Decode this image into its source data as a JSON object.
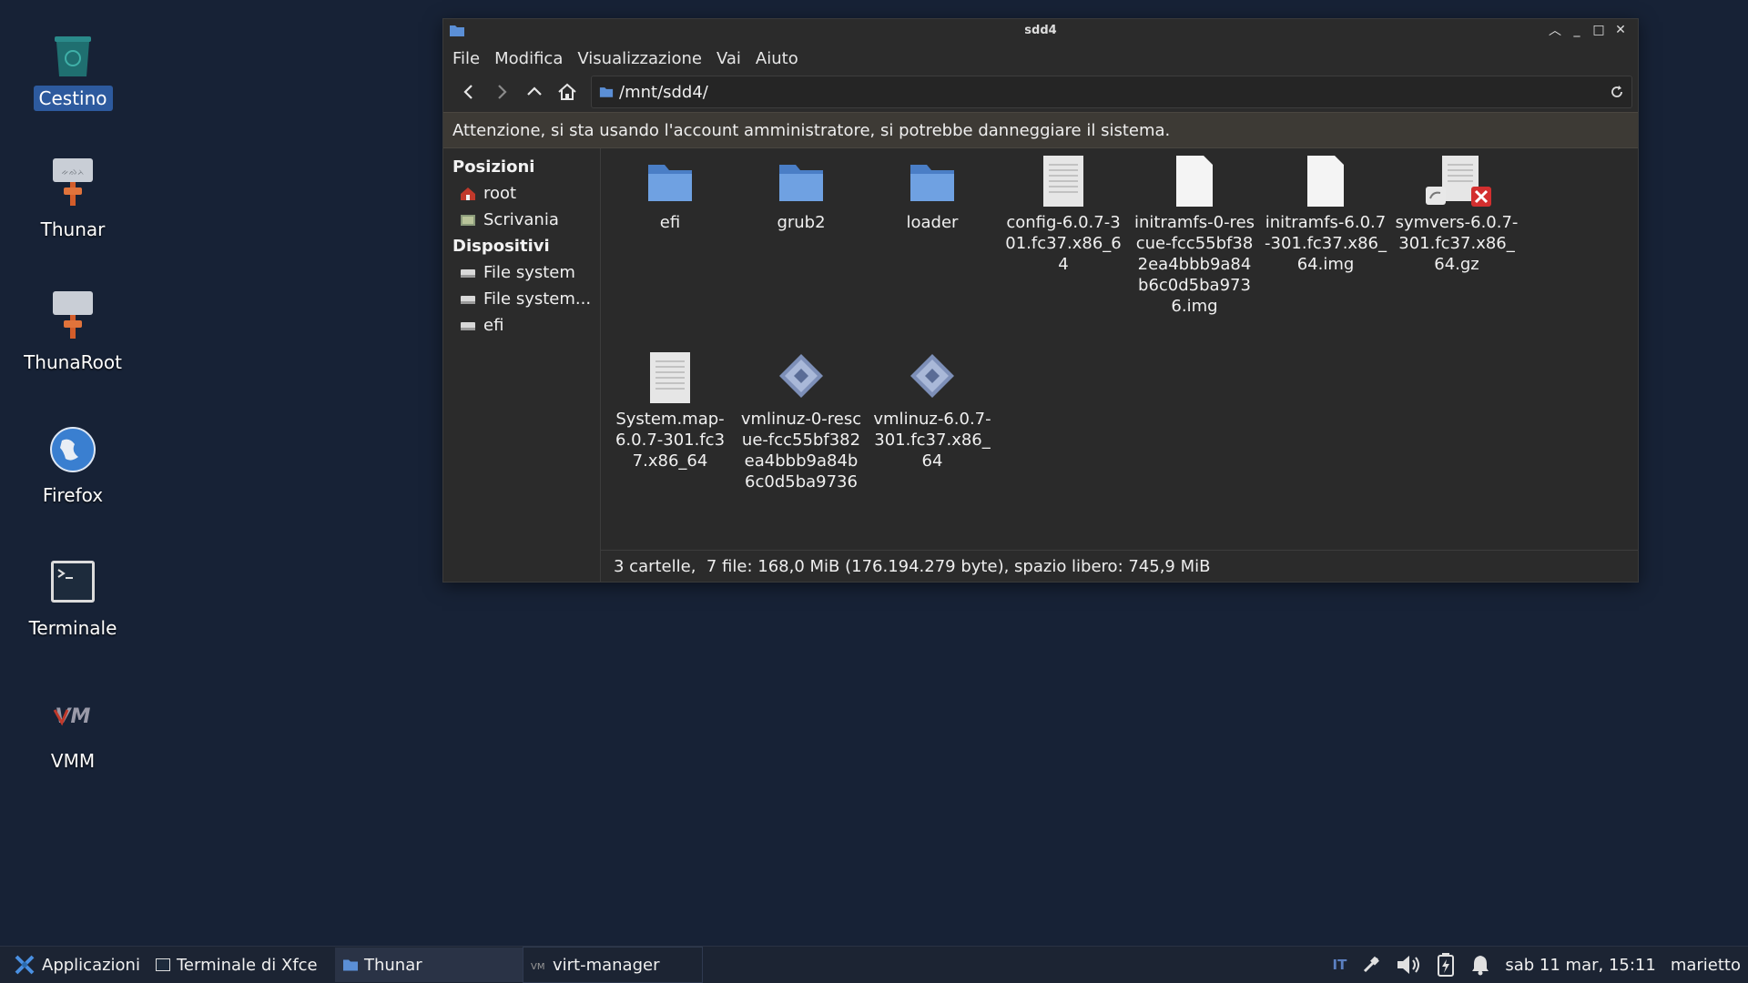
{
  "desktop": {
    "icons": [
      {
        "label": "Cestino",
        "icon": "trash-icon"
      },
      {
        "label": "Thunar",
        "icon": "file-manager-icon"
      },
      {
        "label": "ThunaRoot",
        "icon": "file-manager-icon"
      },
      {
        "label": "Firefox",
        "icon": "globe-icon"
      },
      {
        "label": "Terminale",
        "icon": "terminal-icon"
      },
      {
        "label": "VMM",
        "icon": "vmm-logo-icon"
      }
    ]
  },
  "window": {
    "title": "sdd4",
    "menu": [
      "File",
      "Modifica",
      "Visualizzazione",
      "Vai",
      "Aiuto"
    ],
    "location": "/mnt/sdd4/",
    "warning": "Attenzione, si sta usando l'account amministratore, si potrebbe danneggiare il sistema.",
    "sidebar": {
      "places_header": "Posizioni",
      "places": [
        {
          "label": "root",
          "icon": "home-icon"
        },
        {
          "label": "Scrivania",
          "icon": "desktop-icon"
        }
      ],
      "devices_header": "Dispositivi",
      "devices": [
        {
          "label": "File system",
          "icon": "drive-icon"
        },
        {
          "label": "File system...",
          "icon": "drive-icon"
        },
        {
          "label": "efi",
          "icon": "drive-icon"
        }
      ]
    },
    "files": [
      {
        "name": "efi",
        "type": "folder"
      },
      {
        "name": "grub2",
        "type": "folder"
      },
      {
        "name": "loader",
        "type": "folder"
      },
      {
        "name": "config-6.0.7-301.fc37.x86_64",
        "type": "text"
      },
      {
        "name": "initramfs-0-rescue-fcc55bf382ea4bbb9a84b6c0d5ba9736.img",
        "type": "blank"
      },
      {
        "name": "initramfs-6.0.7-301.fc37.x86_64.img",
        "type": "blank"
      },
      {
        "name": "symvers-6.0.7-301.fc37.x86_64.gz",
        "type": "broken-link"
      },
      {
        "name": "System.map-6.0.7-301.fc37.x86_64",
        "type": "text"
      },
      {
        "name": "vmlinuz-0-rescue-fcc55bf382ea4bbb9a84b6c0d5ba9736",
        "type": "executable"
      },
      {
        "name": "vmlinuz-6.0.7-301.fc37.x86_64",
        "type": "executable"
      }
    ],
    "status": "3 cartelle,  7 file: 168,0 MiB (176.194.279 byte), spazio libero: 745,9 MiB"
  },
  "taskbar": {
    "apps_label": "Applicazioni",
    "tasks": [
      {
        "label": "Terminale di Xfce"
      },
      {
        "label": "Thunar"
      },
      {
        "label": "virt-manager"
      }
    ],
    "keyboard_layout": "IT",
    "clock": "sab 11 mar, 15:11",
    "user": "marietto"
  },
  "colors": {
    "desktop_bg": "#172236",
    "selection": "#2d5a9e",
    "folder": "#5b8fd6"
  }
}
